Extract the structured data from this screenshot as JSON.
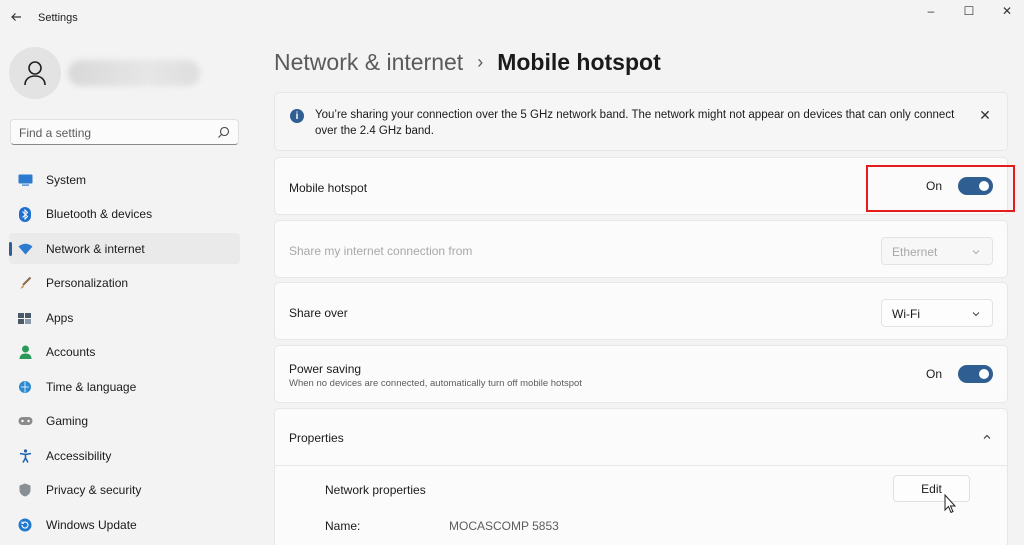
{
  "titlebar": {
    "title": "Settings",
    "minimize_glyph": "–",
    "maximize_glyph": "☐",
    "close_glyph": "✕"
  },
  "search": {
    "placeholder": "Find a setting"
  },
  "nav": {
    "items": [
      {
        "label": "System",
        "icon": "system-icon"
      },
      {
        "label": "Bluetooth & devices",
        "icon": "bluetooth-icon"
      },
      {
        "label": "Network & internet",
        "icon": "wifi-icon",
        "active": true
      },
      {
        "label": "Personalization",
        "icon": "brush-icon"
      },
      {
        "label": "Apps",
        "icon": "apps-icon"
      },
      {
        "label": "Accounts",
        "icon": "person-icon"
      },
      {
        "label": "Time & language",
        "icon": "globe-icon"
      },
      {
        "label": "Gaming",
        "icon": "gamepad-icon"
      },
      {
        "label": "Accessibility",
        "icon": "accessibility-icon"
      },
      {
        "label": "Privacy & security",
        "icon": "shield-icon"
      },
      {
        "label": "Windows Update",
        "icon": "update-icon"
      }
    ]
  },
  "breadcrumb": {
    "parent": "Network & internet",
    "separator": "›",
    "current": "Mobile hotspot"
  },
  "info": {
    "text": "You’re sharing your connection over the 5 GHz network band. The network might not appear on devices that can only connect over the 2.4 GHz band."
  },
  "hotspot": {
    "label": "Mobile hotspot",
    "state": "On"
  },
  "share_from": {
    "label": "Share my internet connection from",
    "value": "Ethernet"
  },
  "share_over": {
    "label": "Share over",
    "value": "Wi-Fi"
  },
  "power_saving": {
    "label": "Power saving",
    "sublabel": "When no devices are connected, automatically turn off mobile hotspot",
    "state": "On"
  },
  "properties": {
    "title": "Properties",
    "network_properties_label": "Network properties",
    "edit_label": "Edit",
    "name_label": "Name:",
    "name_value": "MOCASCOMP 5853"
  },
  "colors": {
    "accent": "#2f5e93",
    "highlight": "#e41c1c"
  }
}
